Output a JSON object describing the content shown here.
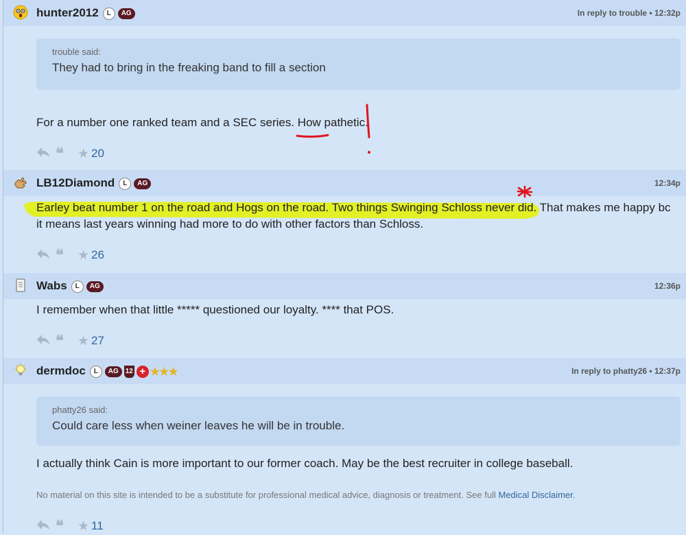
{
  "posts": [
    {
      "username": "hunter2012",
      "badge_l": "L",
      "badge_ag": "AG",
      "avatar_icon": "surprised-face-icon",
      "meta": "In reply to trouble • 12:32p",
      "quote": {
        "author": "trouble said:",
        "text": "They had to bring in the freaking band to fill a section"
      },
      "text": "For a number one ranked team and a SEC series. How pathetic.",
      "count": "20"
    },
    {
      "username": "LB12Diamond",
      "badge_l": "L",
      "badge_ag": "AG",
      "avatar_icon": "hand-icon",
      "meta": "12:34p",
      "text": "Earley beat number 1 on the road and Hogs on the road. Two things Swinging Schloss never did. That makes me happy bc it means last years winning had more to do with other factors than Schloss.",
      "count": "26"
    },
    {
      "username": "Wabs",
      "badge_l": "L",
      "badge_ag": "AG",
      "avatar_icon": "notepad-icon",
      "meta": "12:36p",
      "text": "I remember when that little ***** questioned our loyalty. **** that POS.",
      "count": "27"
    },
    {
      "username": "dermdoc",
      "badge_l": "L",
      "badge_ag": "AG",
      "badge_12": "12",
      "badge_cross": "+",
      "stars": "★★★",
      "avatar_icon": "lightbulb-icon",
      "meta": "In reply to phatty26 • 12:37p",
      "quote": {
        "author": "phatty26 said:",
        "text": "Could care less when weiner leaves he will be in trouble."
      },
      "text": "I actually think Cain is more important to our former coach. May be the best recruiter in college baseball.",
      "disclaimer": "No material on this site is intended to be a substitute for professional medical advice, diagnosis or treatment. See full",
      "disclaimer_link": "Medical Disclaimer",
      "disclaimer_end": ".",
      "count": "11"
    }
  ],
  "colors": {
    "badge_ag": "#5a1a24",
    "highlight": "#e4f200",
    "annotation_red": "#e0141c",
    "link": "#336699"
  }
}
